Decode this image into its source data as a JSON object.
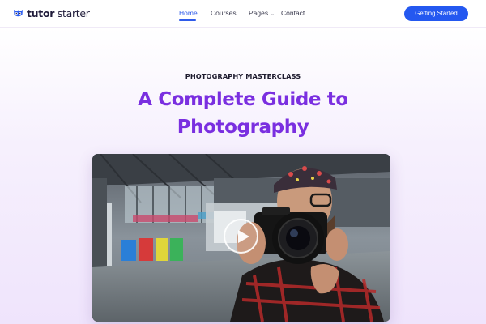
{
  "header": {
    "logo_bold": "tutor",
    "logo_light": " starter",
    "logo_icon": "owl-logo-icon",
    "nav": [
      {
        "label": "Home",
        "active": true
      },
      {
        "label": "Courses",
        "active": false
      },
      {
        "label": "Pages",
        "active": false,
        "has_dropdown": true
      },
      {
        "label": "Contact",
        "active": false
      }
    ],
    "cta_label": "Getting Started"
  },
  "hero": {
    "eyebrow": "PHOTOGRAPHY MASTERCLASS",
    "title_line1": "A Complete Guide to",
    "title_line2": "Photography",
    "video_poster": "photographer-with-camera-image",
    "play_icon": "play-icon"
  },
  "colors": {
    "accent": "#2458f0",
    "headline": "#7a2fe0",
    "nav_active": "#2f5bea"
  }
}
